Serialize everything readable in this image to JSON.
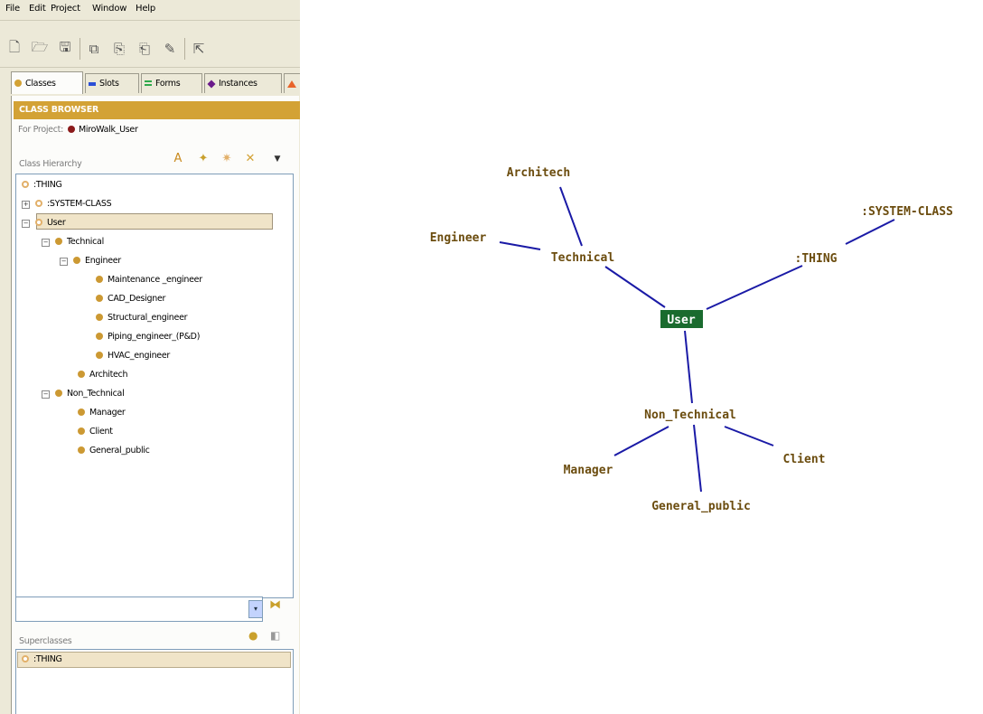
{
  "menubar": [
    "File",
    "Edit",
    "Project",
    "Window",
    "Help"
  ],
  "tabs": [
    {
      "label": "Classes",
      "color": "#d3a235",
      "active": true
    },
    {
      "label": "Slots",
      "color": "#2b4fd6",
      "active": false
    },
    {
      "label": "Forms",
      "color": "#2ea84b",
      "active": false
    },
    {
      "label": "Instances",
      "color": "#6a1a8a",
      "active": false
    },
    {
      "label": "",
      "color": "#e8632a",
      "active": false
    }
  ],
  "class_browser": {
    "title": "CLASS BROWSER",
    "for_project_label": "For Project:",
    "project_name": "MiroWalk_User",
    "hierarchy_title": "Class Hierarchy"
  },
  "tree": [
    {
      "label": ":THING",
      "depth": 0,
      "expander": "",
      "kind": "system"
    },
    {
      "label": ":SYSTEM-CLASS",
      "depth": 0,
      "expander": "+",
      "kind": "system"
    },
    {
      "label": "User",
      "depth": 0,
      "expander": "−",
      "kind": "system",
      "selected": true
    },
    {
      "label": "Technical",
      "depth": 1,
      "expander": "−",
      "kind": "class"
    },
    {
      "label": "Engineer",
      "depth": 2,
      "expander": "−",
      "kind": "class"
    },
    {
      "label": "Maintenance _engineer",
      "depth": 3,
      "expander": "",
      "kind": "class"
    },
    {
      "label": "CAD_Designer",
      "depth": 3,
      "expander": "",
      "kind": "class"
    },
    {
      "label": "Structural_engineer",
      "depth": 3,
      "expander": "",
      "kind": "class"
    },
    {
      "label": "Piping_engineer_(P&D)",
      "depth": 3,
      "expander": "",
      "kind": "class"
    },
    {
      "label": "HVAC_engineer",
      "depth": 3,
      "expander": "",
      "kind": "class"
    },
    {
      "label": "Architech",
      "depth": 2,
      "expander": "",
      "kind": "class"
    },
    {
      "label": "Non_Technical",
      "depth": 1,
      "expander": "−",
      "kind": "class"
    },
    {
      "label": "Manager",
      "depth": 2,
      "expander": "",
      "kind": "class"
    },
    {
      "label": "Client",
      "depth": 2,
      "expander": "",
      "kind": "class"
    },
    {
      "label": "General_public",
      "depth": 2,
      "expander": "",
      "kind": "class"
    }
  ],
  "superclasses": {
    "title": "Superclasses",
    "items": [
      ":THING"
    ]
  },
  "graph": {
    "center": "User",
    "nodes": [
      ":THING",
      ":SYSTEM-CLASS",
      "Technical",
      "Engineer",
      "Architech",
      "Non_Technical",
      "Manager",
      "Client",
      "General_public"
    ],
    "edge_color": "#1a1aa6",
    "center_color": "#1a6b2e",
    "label_color": "#6b4c0e"
  }
}
